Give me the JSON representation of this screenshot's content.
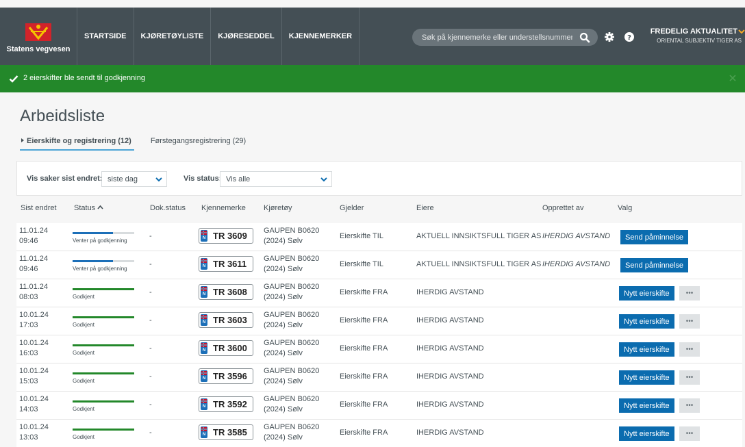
{
  "header": {
    "logo_text": "Statens vegvesen",
    "nav": [
      "STARTSIDE",
      "KJØRETØYLISTE",
      "KJØRESEDDEL",
      "KJENNEMERKER"
    ],
    "search_placeholder": "Søk på kjennemerke eller understellsnummer",
    "user_name": "FREDELIG AKTUALITET",
    "user_org": "ORIENTAL SUBJEKTIV TIGER AS"
  },
  "banner": {
    "message": "2 eierskifter ble sendt til godkjenning"
  },
  "page": {
    "title": "Arbeidsliste",
    "tabs": [
      {
        "label": "Eierskifte og registrering (12)",
        "active": true
      },
      {
        "label": "Førstegangsregistrering (29)",
        "active": false
      }
    ]
  },
  "filters": {
    "changed_label": "Vis saker sist endret:",
    "changed_value": "siste dag",
    "status_label": "Vis status:",
    "status_value": "Vis alle"
  },
  "table": {
    "columns": [
      "Sist endret",
      "Status",
      "Dok.status",
      "Kjennemerke",
      "Kjøretøy",
      "Gjelder",
      "Eiere",
      "Opprettet av",
      "Valg"
    ],
    "rows": [
      {
        "date": "11.01.24",
        "time": "09:46",
        "status": "Venter på godkjenning",
        "progress": 0.66,
        "dok": "-",
        "plate": "TR 3609",
        "vehicle_1": "GAUPEN B0620",
        "vehicle_2": "(2024) Sølv",
        "gjelder": "Eierskifte TIL",
        "eiere": "AKTUELL INNSIKTSFULL TIGER AS",
        "opprettet": "IHERDIG AVSTAND",
        "action": "Send påminnelse",
        "more": ""
      },
      {
        "date": "11.01.24",
        "time": "09:46",
        "status": "Venter på godkjenning",
        "progress": 0.66,
        "dok": "-",
        "plate": "TR 3611",
        "vehicle_1": "GAUPEN B0620",
        "vehicle_2": "(2024) Sølv",
        "gjelder": "Eierskifte TIL",
        "eiere": "AKTUELL INNSIKTSFULL TIGER AS",
        "opprettet": "IHERDIG AVSTAND",
        "action": "Send påminnelse",
        "more": ""
      },
      {
        "date": "11.01.24",
        "time": "08:03",
        "status": "Godkjent",
        "progress": 1,
        "dok": "-",
        "plate": "TR 3608",
        "vehicle_1": "GAUPEN B0620",
        "vehicle_2": "(2024) Sølv",
        "gjelder": "Eierskifte FRA",
        "eiere": "IHERDIG AVSTAND",
        "opprettet": "",
        "action": "Nytt eierskifte",
        "more": "•••"
      },
      {
        "date": "10.01.24",
        "time": "17:03",
        "status": "Godkjent",
        "progress": 1,
        "dok": "-",
        "plate": "TR 3603",
        "vehicle_1": "GAUPEN B0620",
        "vehicle_2": "(2024) Sølv",
        "gjelder": "Eierskifte FRA",
        "eiere": "IHERDIG AVSTAND",
        "opprettet": "",
        "action": "Nytt eierskifte",
        "more": "•••"
      },
      {
        "date": "10.01.24",
        "time": "16:03",
        "status": "Godkjent",
        "progress": 1,
        "dok": "-",
        "plate": "TR 3600",
        "vehicle_1": "GAUPEN B0620",
        "vehicle_2": "(2024) Sølv",
        "gjelder": "Eierskifte FRA",
        "eiere": "IHERDIG AVSTAND",
        "opprettet": "",
        "action": "Nytt eierskifte",
        "more": "•••"
      },
      {
        "date": "10.01.24",
        "time": "15:03",
        "status": "Godkjent",
        "progress": 1,
        "dok": "-",
        "plate": "TR 3596",
        "vehicle_1": "GAUPEN B0620",
        "vehicle_2": "(2024) Sølv",
        "gjelder": "Eierskifte FRA",
        "eiere": "IHERDIG AVSTAND",
        "opprettet": "",
        "action": "Nytt eierskifte",
        "more": "•••"
      },
      {
        "date": "10.01.24",
        "time": "14:03",
        "status": "Godkjent",
        "progress": 1,
        "dok": "-",
        "plate": "TR 3592",
        "vehicle_1": "GAUPEN B0620",
        "vehicle_2": "(2024) Sølv",
        "gjelder": "Eierskifte FRA",
        "eiere": "IHERDIG AVSTAND",
        "opprettet": "",
        "action": "Nytt eierskifte",
        "more": "•••"
      },
      {
        "date": "10.01.24",
        "time": "13:03",
        "status": "Godkjent",
        "progress": 1,
        "dok": "-",
        "plate": "TR 3585",
        "vehicle_1": "GAUPEN B0620",
        "vehicle_2": "(2024) Sølv",
        "gjelder": "Eierskifte FRA",
        "eiere": "IHERDIG AVSTAND",
        "opprettet": "",
        "action": "Nytt eierskifte",
        "more": "•••"
      }
    ]
  },
  "colors": {
    "header_bg": "#444f55",
    "banner_green": "#23882a",
    "primary_blue": "#0b6caf",
    "progress_pending": "#1c6fb8",
    "progress_done": "#23882a"
  },
  "icons": [
    "logo-shield-icon",
    "search-icon",
    "gear-icon",
    "help-icon",
    "chevron-down-icon",
    "check-icon",
    "close-icon",
    "sort-up-icon",
    "plate-flag-icon"
  ]
}
